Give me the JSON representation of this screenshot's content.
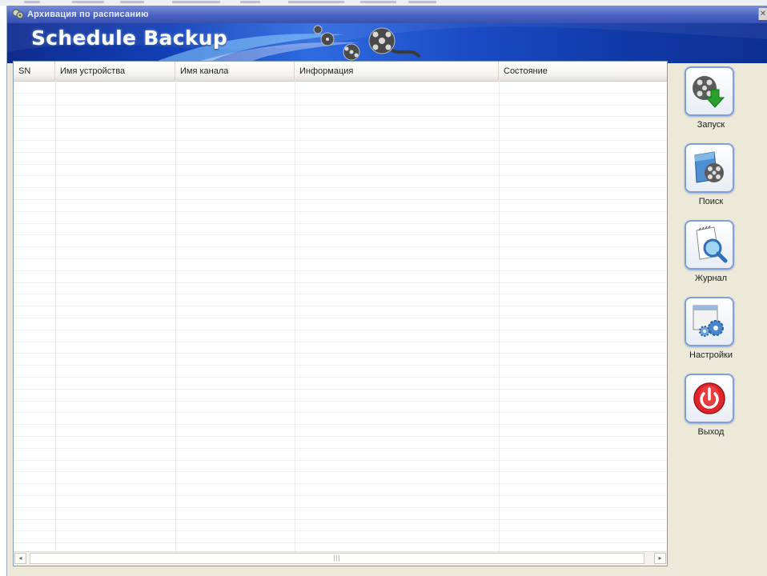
{
  "window": {
    "title": "Архивация по расписанию",
    "close_glyph": "✕"
  },
  "banner": {
    "title": "Schedule Backup"
  },
  "table": {
    "columns": [
      {
        "label": "SN"
      },
      {
        "label": "Имя устройства"
      },
      {
        "label": "Имя канала"
      },
      {
        "label": "Информация"
      },
      {
        "label": "Состояние"
      }
    ],
    "rows": []
  },
  "scrollbar": {
    "left_arrow": "◂",
    "right_arrow": "▸",
    "thumb_grip": "|||"
  },
  "toolbar": {
    "buttons": [
      {
        "label": "Запуск",
        "icon": "film-reel-download-icon"
      },
      {
        "label": "Поиск",
        "icon": "film-reel-folder-icon"
      },
      {
        "label": "Журнал",
        "icon": "log-magnifier-icon"
      },
      {
        "label": "Настройки",
        "icon": "settings-gears-icon"
      },
      {
        "label": "Выход",
        "icon": "power-icon",
        "color": "#e0262a"
      }
    ]
  },
  "colors": {
    "banner": "#1240b8",
    "titlebar": "#4b63c4",
    "button_border": "#7f9fd8"
  }
}
